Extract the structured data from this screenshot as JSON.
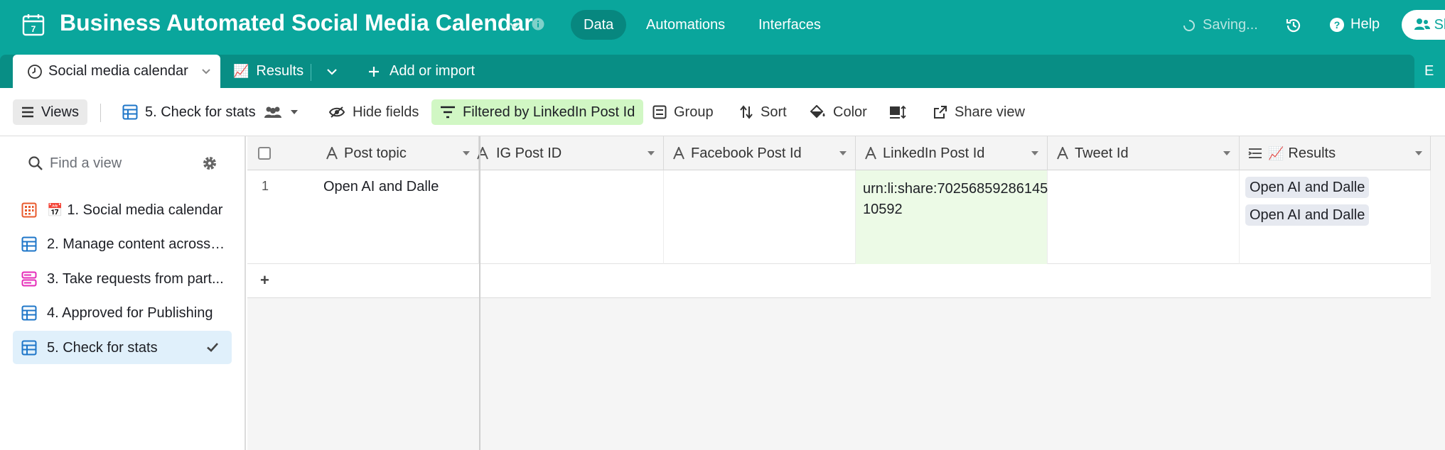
{
  "app": {
    "title": "Business Automated Social Media Calendar",
    "nav": {
      "data": "Data",
      "automations": "Automations",
      "interfaces": "Interfaces"
    },
    "status": "Saving...",
    "help": "Help",
    "share": "Share"
  },
  "tabs": {
    "active": "Social media calendar",
    "results": "Results",
    "results_icon": "📈",
    "add": "Add or import",
    "cut": "E"
  },
  "toolbar": {
    "views": "Views",
    "current_view": "5. Check for stats",
    "hide_fields": "Hide fields",
    "filter": "Filtered by LinkedIn Post Id",
    "group": "Group",
    "sort": "Sort",
    "color": "Color",
    "share_view": "Share view"
  },
  "sidebar": {
    "search_placeholder": "Find a view",
    "items": [
      {
        "label": "1. Social media calendar",
        "emoji": "📅",
        "type": "calendar"
      },
      {
        "label": "2. Manage content across ...",
        "type": "grid"
      },
      {
        "label": "3. Take requests from part...",
        "type": "form"
      },
      {
        "label": "4. Approved for Publishing",
        "type": "grid"
      },
      {
        "label": "5. Check for stats",
        "type": "grid",
        "selected": true
      }
    ]
  },
  "grid": {
    "columns": [
      {
        "name": "Post topic",
        "icon": "text-field-icon"
      },
      {
        "name": "IG Post ID",
        "icon": "text-field-icon"
      },
      {
        "name": "Facebook Post Id",
        "icon": "text-field-icon"
      },
      {
        "name": "LinkedIn Post Id",
        "icon": "text-field-icon"
      },
      {
        "name": "Tweet Id",
        "icon": "text-field-icon"
      },
      {
        "name": "Results",
        "icon": "lookup-field-icon",
        "emoji": "📈"
      }
    ],
    "rows": [
      {
        "number": "1",
        "post_topic": "Open AI and Dalle",
        "ig_post_id": "",
        "facebook_post_id": "",
        "linkedin_post_id": "urn:li:share:7025685928614510592",
        "linkedin_line1": "urn:li:share:70256859286145",
        "linkedin_line2": "10592",
        "tweet_id": "",
        "results": [
          "Open AI and Dalle",
          "Open AI and Dalle"
        ]
      }
    ],
    "add_row": "+"
  },
  "colors": {
    "brand": "#0aa69c",
    "brand_dark": "#07877f",
    "filter_bg": "#d1f7c4",
    "filtered_cell_bg": "#ecfae6",
    "selected_view_bg": "#e0f0fb",
    "chip_bg": "#e6e9f0"
  }
}
